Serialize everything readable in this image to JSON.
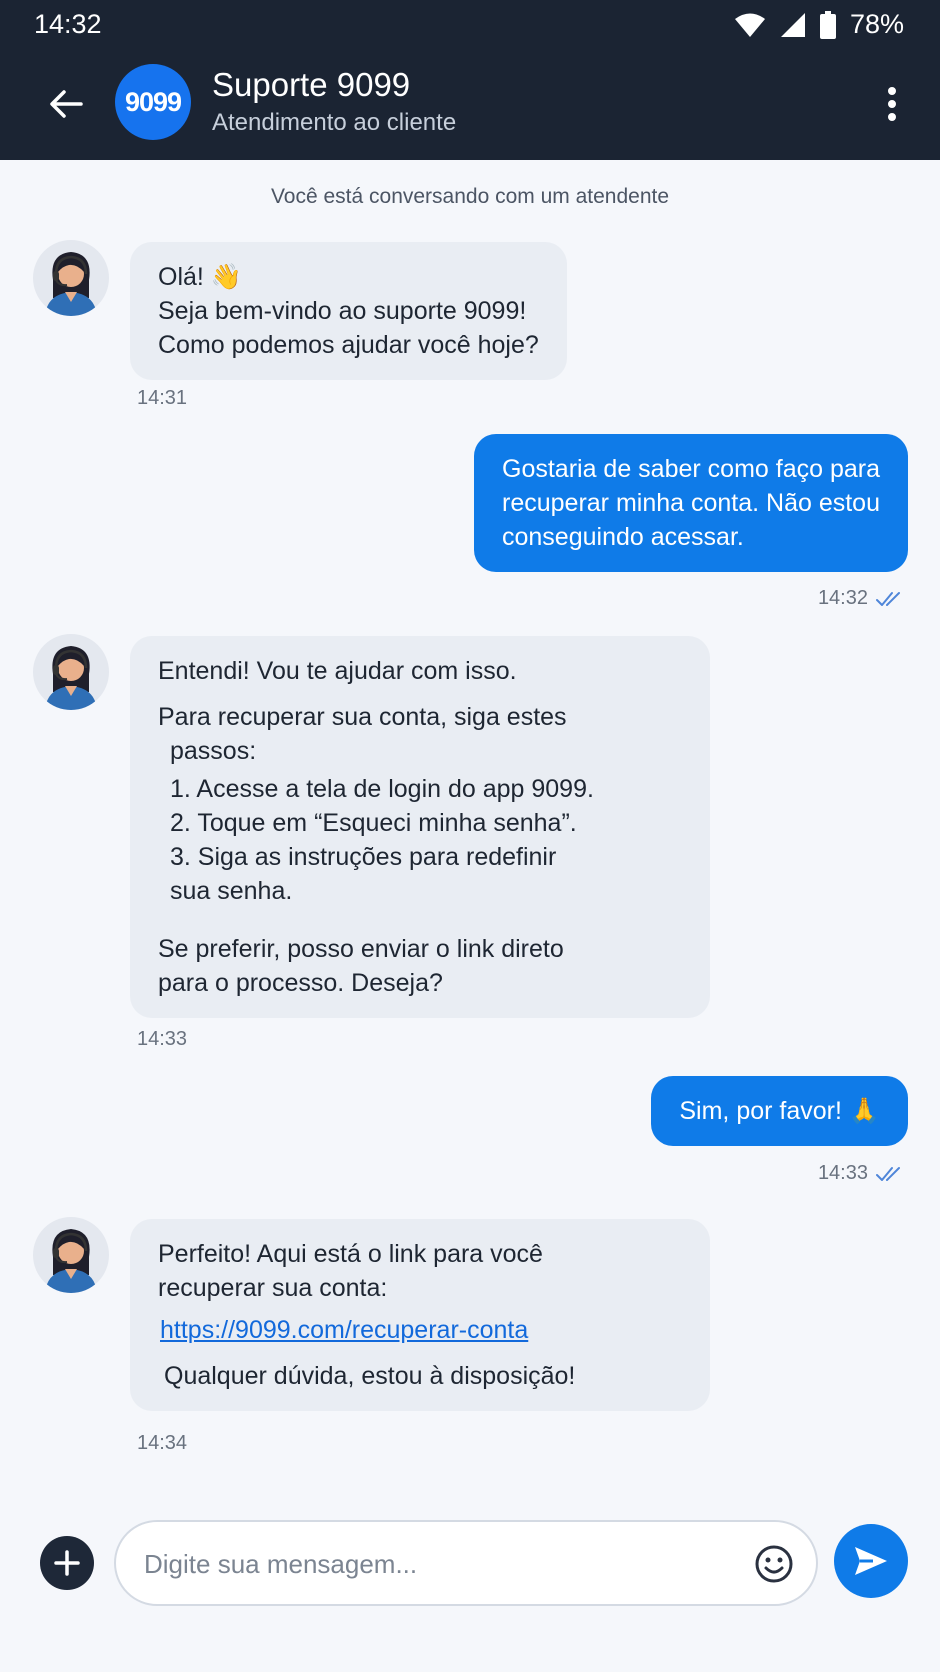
{
  "status": {
    "time": "14:32",
    "battery": "78%"
  },
  "header": {
    "logo_text": "9099",
    "title": "Suporte 9099",
    "subtitle": "Atendimento ao cliente"
  },
  "notice": "Você está conversando com um atendente",
  "messages": [
    {
      "from": "agent",
      "lines": [
        "Olá! 👋",
        "Seja bem-vindo ao suporte 9099!",
        "Como podemos ajudar você hoje?"
      ],
      "time": "14:31"
    },
    {
      "from": "user",
      "lines": [
        "Gostaria de saber como faço para",
        "recuperar minha conta. Não estou",
        "conseguindo acessar."
      ],
      "time": "14:32"
    },
    {
      "from": "agent",
      "intro": "Entendi! Vou te ajudar com isso.",
      "para_1": "Para recuperar sua conta, siga estes",
      "para_2": "passos:",
      "steps": [
        "1. Acesse a tela de login do app 9099.",
        "2. Toque em “Esqueci minha senha”.",
        "3. Siga as instruções para redefinir",
        "sua senha."
      ],
      "outro": [
        "Se preferir, posso enviar o link direto",
        "para o processo. Deseja?"
      ],
      "time": "14:33"
    },
    {
      "from": "user",
      "lines": [
        "Sim, por favor! 🙏"
      ],
      "time": "14:33"
    },
    {
      "from": "agent",
      "lines": [
        "Perfeito! Aqui está o link para você",
        "recuperar sua conta:"
      ],
      "link": "https://9099.com/recuperar-conta",
      "closing": "Qualquer dúvida, estou à disposição!",
      "time": "14:34"
    }
  ],
  "composer": {
    "placeholder": "Digite sua mensagem..."
  },
  "colors": {
    "header_bg": "#1b2433",
    "accent": "#0f7be8",
    "incoming_bubble": "#e9edf3",
    "page_bg": "#f5f7fb"
  },
  "icons": [
    "wifi-icon",
    "signal-icon",
    "battery-icon",
    "back-arrow-icon",
    "more-vert-icon",
    "double-check-icon",
    "plus-icon",
    "emoji-icon",
    "send-icon",
    "agent-avatar"
  ]
}
